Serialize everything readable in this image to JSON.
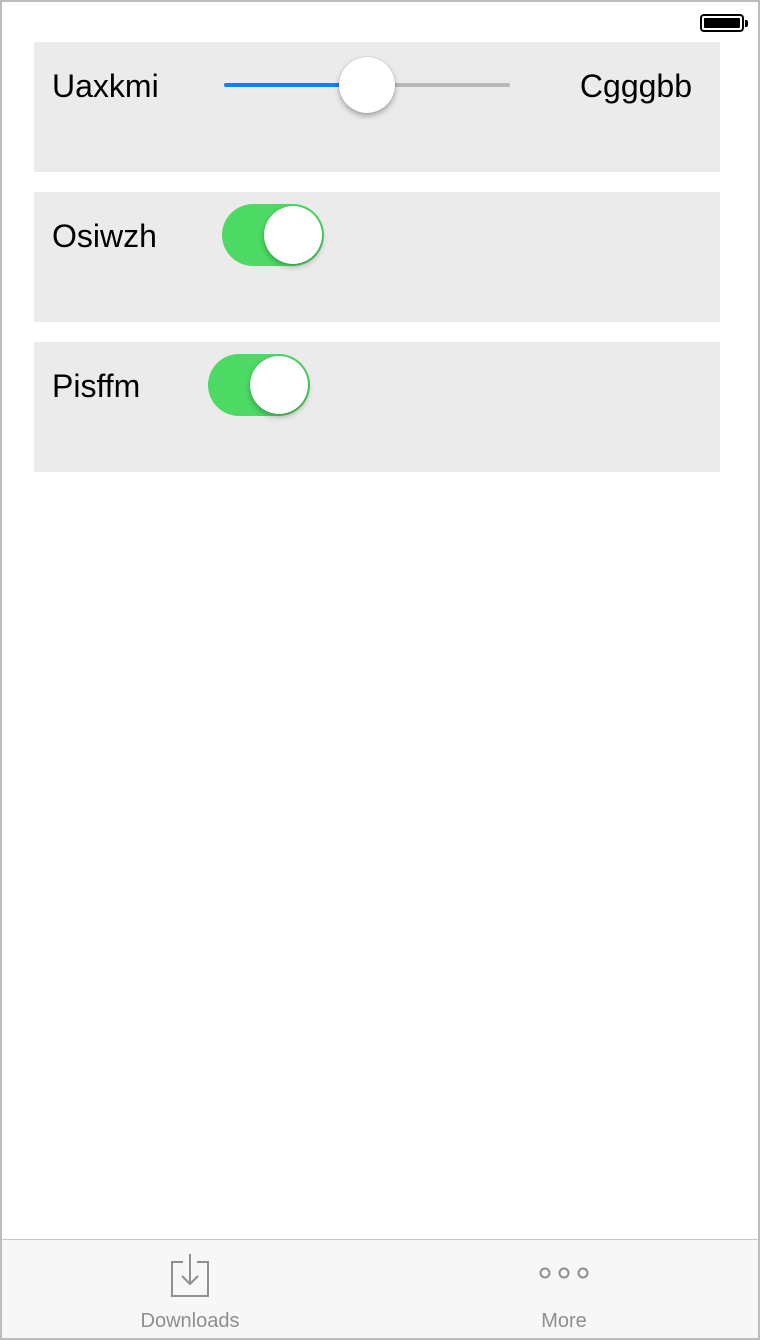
{
  "status_bar": {
    "battery_icon": "battery-full-icon"
  },
  "settings": {
    "slider_row": {
      "left_label": "Uaxkmi",
      "right_label": "Cgggbb",
      "value_fraction": 0.5
    },
    "toggle_rows": [
      {
        "label": "Osiwzh",
        "on": true
      },
      {
        "label": "Pisffm",
        "on": true
      }
    ]
  },
  "tab_bar": {
    "tabs": [
      {
        "label": "Downloads",
        "icon": "download-icon"
      },
      {
        "label": "More",
        "icon": "more-icon"
      }
    ]
  },
  "colors": {
    "accent": "#1a7cf1",
    "toggle_on": "#4cd964",
    "card_background": "#ebebeb",
    "tab_label": "#8e8e93"
  }
}
